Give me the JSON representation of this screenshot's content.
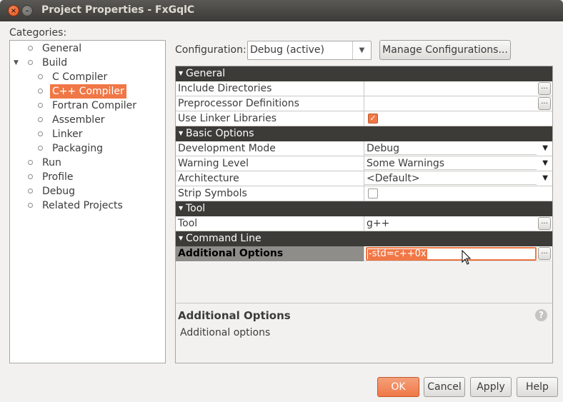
{
  "window": {
    "title": "Project Properties - FxGqlC"
  },
  "categories": {
    "label": "Categories:",
    "items": [
      {
        "label": "General",
        "level": 0
      },
      {
        "label": "Build",
        "level": 0,
        "expanded": true
      },
      {
        "label": "C Compiler",
        "level": 1
      },
      {
        "label": "C++ Compiler",
        "level": 1,
        "selected": true
      },
      {
        "label": "Fortran Compiler",
        "level": 1
      },
      {
        "label": "Assembler",
        "level": 1
      },
      {
        "label": "Linker",
        "level": 1
      },
      {
        "label": "Packaging",
        "level": 1
      },
      {
        "label": "Run",
        "level": 0
      },
      {
        "label": "Profile",
        "level": 0
      },
      {
        "label": "Debug",
        "level": 0
      },
      {
        "label": "Related Projects",
        "level": 0
      }
    ]
  },
  "configuration": {
    "label": "Configuration:",
    "value": "Debug (active)",
    "manage_label": "Manage Configurations..."
  },
  "sheet": {
    "sections": [
      {
        "title": "General"
      },
      {
        "title": "Basic Options"
      },
      {
        "title": "Tool"
      },
      {
        "title": "Command Line"
      }
    ],
    "rows": {
      "include_directories": {
        "name": "Include Directories",
        "value": ""
      },
      "preprocessor_definitions": {
        "name": "Preprocessor Definitions",
        "value": ""
      },
      "use_linker_libraries": {
        "name": "Use Linker Libraries",
        "checked": true
      },
      "development_mode": {
        "name": "Development Mode",
        "value": "Debug"
      },
      "warning_level": {
        "name": "Warning Level",
        "value": "Some Warnings"
      },
      "architecture": {
        "name": "Architecture",
        "value": "<Default>"
      },
      "strip_symbols": {
        "name": "Strip Symbols",
        "checked": false
      },
      "tool": {
        "name": "Tool",
        "value": "g++"
      },
      "additional_options": {
        "name": "Additional Options",
        "value": "-std=c++0x"
      }
    },
    "ellipsis": "...",
    "description": {
      "title": "Additional Options",
      "text": "Additional options"
    }
  },
  "buttons": {
    "ok": "OK",
    "cancel": "Cancel",
    "apply": "Apply",
    "help": "Help"
  },
  "colors": {
    "accent": "#f07746",
    "section_header": "#3c3b37",
    "titlebar": "#3c3b37"
  }
}
